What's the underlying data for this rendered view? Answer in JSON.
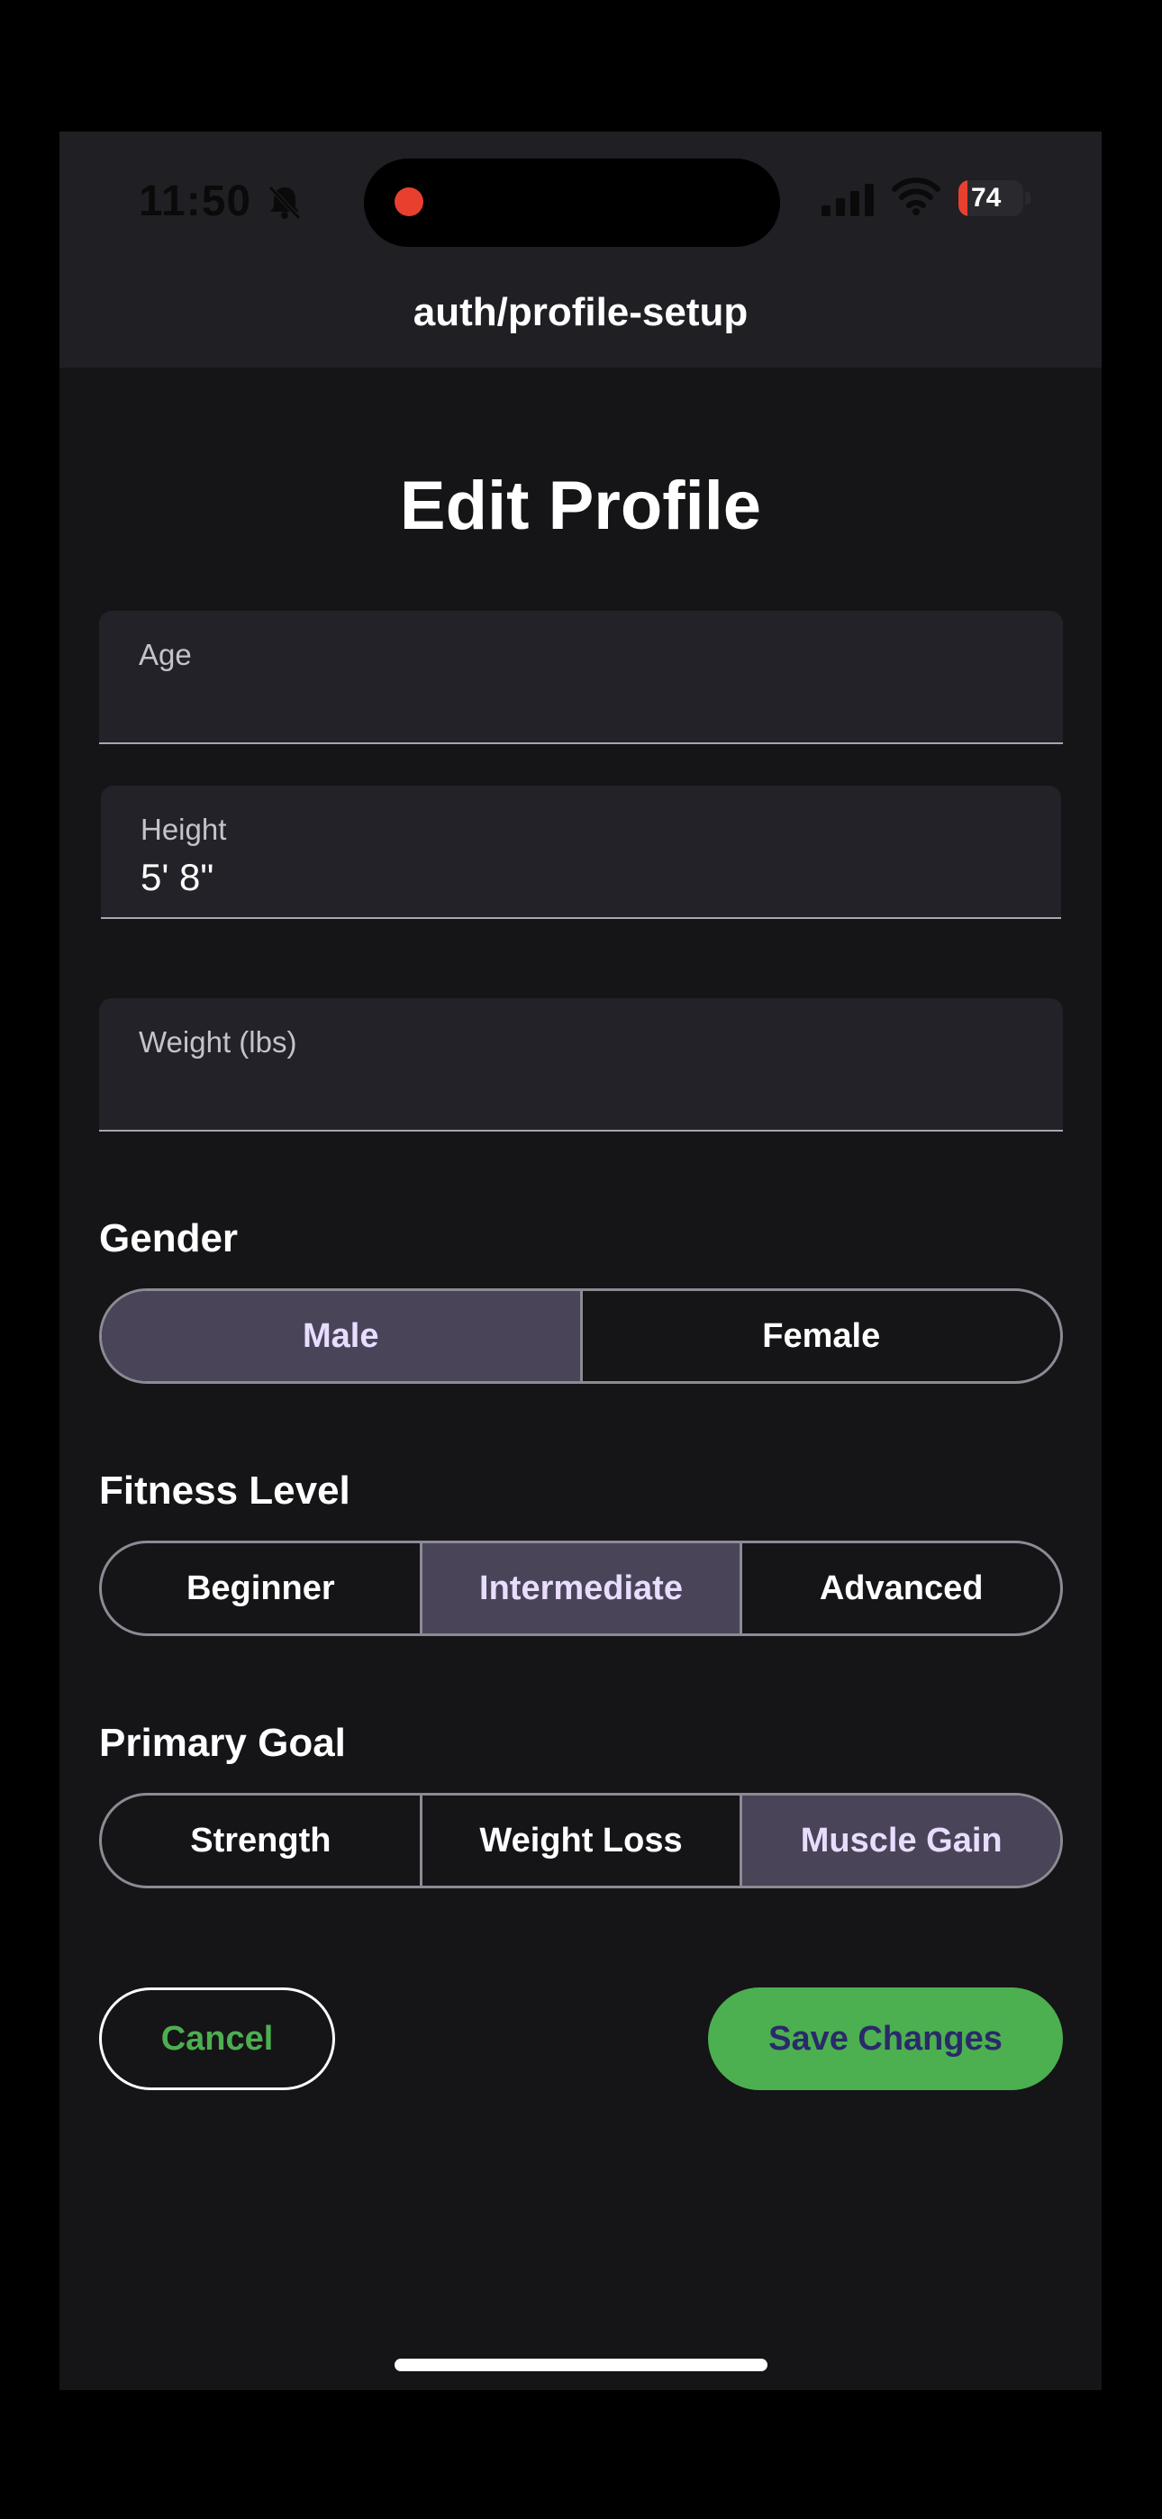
{
  "status_bar": {
    "time": "11:50",
    "battery": "74"
  },
  "header": {
    "route": "auth/profile-setup"
  },
  "page": {
    "title": "Edit Profile"
  },
  "fields": {
    "age": {
      "label": "Age",
      "value": ""
    },
    "height": {
      "label": "Height",
      "value": "5' 8\""
    },
    "weight": {
      "label": "Weight (lbs)",
      "value": ""
    }
  },
  "gender": {
    "label": "Gender",
    "options": [
      "Male",
      "Female"
    ],
    "selected": "Male"
  },
  "fitness_level": {
    "label": "Fitness Level",
    "options": [
      "Beginner",
      "Intermediate",
      "Advanced"
    ],
    "selected": "Intermediate"
  },
  "primary_goal": {
    "label": "Primary Goal",
    "options": [
      "Strength",
      "Weight Loss",
      "Muscle Gain"
    ],
    "selected": "Muscle Gain"
  },
  "actions": {
    "cancel": "Cancel",
    "save": "Save Changes"
  },
  "colors": {
    "accent_green": "#4caf50",
    "selected_segment": "#4a4458",
    "recording_dot": "#e8402f"
  },
  "icons": {
    "status_left": "bell-slash-icon",
    "signal": "cellular-signal-icon",
    "wifi": "wifi-icon",
    "battery": "battery-charging-icon"
  }
}
